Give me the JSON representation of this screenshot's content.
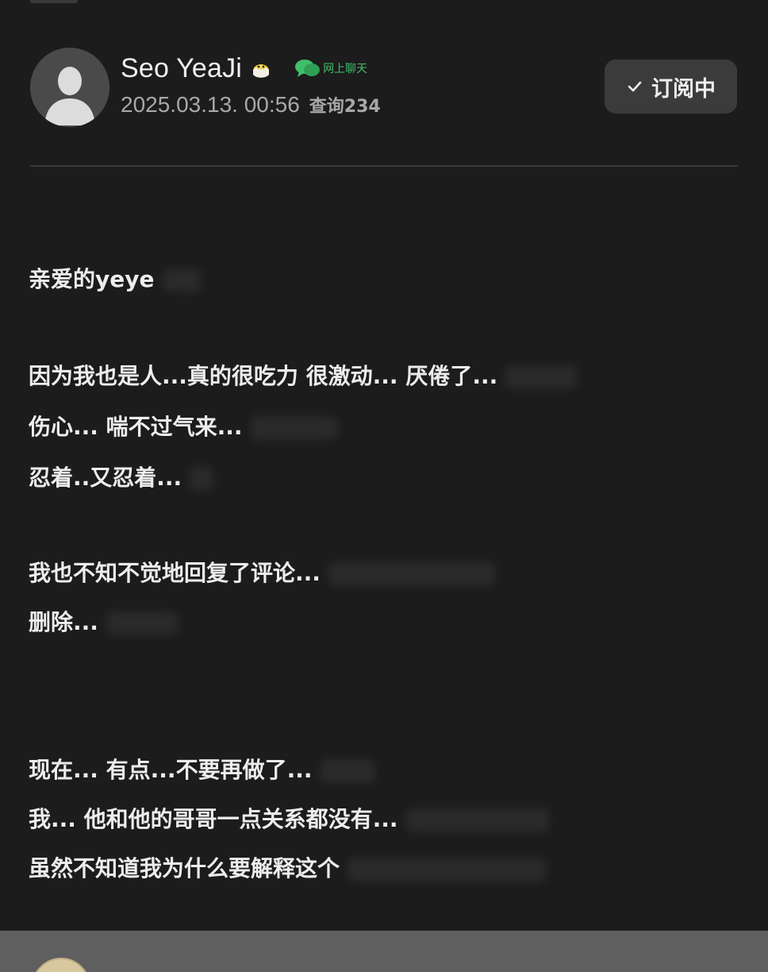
{
  "post": {
    "author": "Seo YeaJi",
    "chat_badge": "网上聊天",
    "date": "2025.03.13. 00:56",
    "views": "查询234",
    "subscribe_label": "订阅中"
  },
  "body_lines": [
    "亲爱的yeye",
    "因为我也是人...真的很吃力 很激动... 厌倦了...",
    "伤心... 喘不过气来...",
    "忍着..又忍着...",
    "我也不知不觉地回复了评论...",
    "删除...",
    "现在... 有点...不要再做了...",
    "我... 他和他的哥哥一点关系都没有...",
    "虽然不知道我为什么要解释这个"
  ],
  "icons": {
    "avatar": "default-user-avatar",
    "author_badge": "chick-icon",
    "chat": "chat-bubble-icon",
    "subscribe": "check-icon"
  },
  "colors": {
    "background": "#1c1c1c",
    "button": "#3b3b3b",
    "chat_green": "#3fbf6a",
    "text": "#ededed",
    "muted": "#a8a8a8"
  }
}
